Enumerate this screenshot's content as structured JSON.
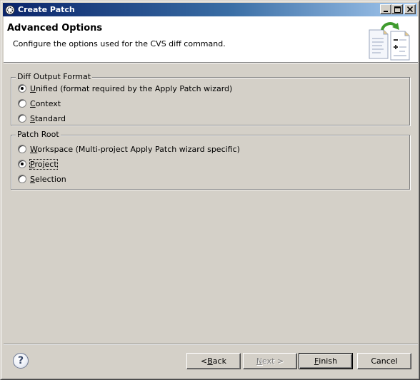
{
  "window": {
    "title": "Create Patch",
    "minimize_label": "_",
    "maximize_label": "□",
    "close_label": "×"
  },
  "header": {
    "title": "Advanced Options",
    "description": "Configure the options used for the CVS diff command.",
    "image_icon": "patch-wizard-icon"
  },
  "diff_output_format": {
    "legend": "Diff Output Format",
    "options": [
      {
        "mnemonic": "U",
        "rest": "nified (format required by the Apply Patch wizard)",
        "checked": true
      },
      {
        "mnemonic": "C",
        "rest": "ontext",
        "checked": false
      },
      {
        "mnemonic": "S",
        "rest": "tandard",
        "checked": false
      }
    ]
  },
  "patch_root": {
    "legend": "Patch Root",
    "options": [
      {
        "mnemonic": "W",
        "rest": "orkspace (Multi-project Apply Patch wizard specific)",
        "checked": false
      },
      {
        "mnemonic": "P",
        "rest": "roject",
        "checked": true
      },
      {
        "mnemonic": "S",
        "rest": "election",
        "checked": false
      }
    ]
  },
  "footer": {
    "help_label": "?",
    "back_prefix": "< ",
    "back_mnemonic": "B",
    "back_rest": "ack",
    "next_mnemonic": "N",
    "next_rest": "ext >",
    "finish_mnemonic": "F",
    "finish_rest": "inish",
    "cancel_label": "Cancel"
  },
  "colors": {
    "titlebar_start": "#0a246a",
    "titlebar_end": "#a6caf0",
    "dialog_bg": "#d4d0c8"
  }
}
